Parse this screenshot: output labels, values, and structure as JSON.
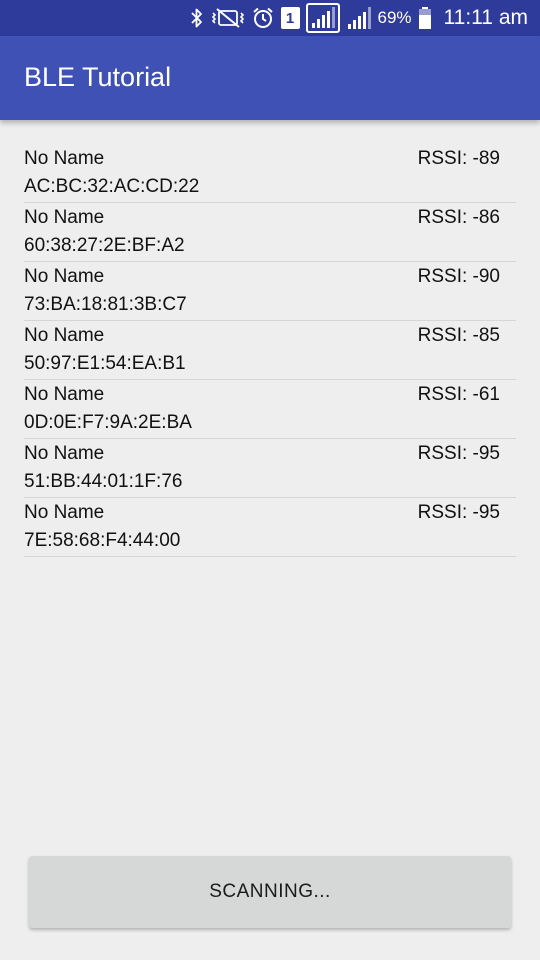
{
  "status_bar": {
    "battery_percent": "69%",
    "time": "11:11 am",
    "sim_slot": "1",
    "icons": [
      "bluetooth-icon",
      "vibrate-mute-icon",
      "alarm-icon",
      "sim-icon",
      "signal-icon",
      "signal-icon-2",
      "battery-icon"
    ]
  },
  "app_bar": {
    "title": "BLE Tutorial",
    "color": "#3f51b5",
    "status_color": "#2e3b9b"
  },
  "devices": [
    {
      "name": "No Name",
      "address": "AC:BC:32:AC:CD:22",
      "rssi": "RSSI: -89"
    },
    {
      "name": "No Name",
      "address": "60:38:27:2E:BF:A2",
      "rssi": "RSSI: -86"
    },
    {
      "name": "No Name",
      "address": "73:BA:18:81:3B:C7",
      "rssi": "RSSI: -90"
    },
    {
      "name": "No Name",
      "address": "50:97:E1:54:EA:B1",
      "rssi": "RSSI: -85"
    },
    {
      "name": "No Name",
      "address": "0D:0E:F7:9A:2E:BA",
      "rssi": "RSSI: -61"
    },
    {
      "name": "No Name",
      "address": "51:BB:44:01:1F:76",
      "rssi": "RSSI: -95"
    },
    {
      "name": "No Name",
      "address": "7E:58:68:F4:44:00",
      "rssi": "RSSI: -95"
    }
  ],
  "scan_button": {
    "label": "SCANNING..."
  }
}
